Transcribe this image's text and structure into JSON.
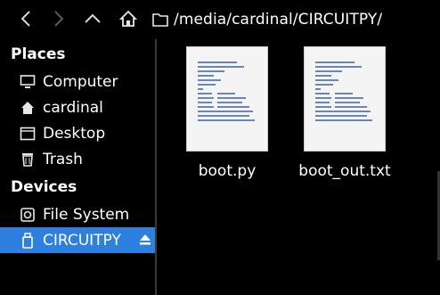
{
  "toolbar": {
    "path": "/media/cardinal/CIRCUITPY/"
  },
  "sidebar": {
    "places_header": "Places",
    "places": [
      {
        "label": "Computer",
        "icon": "monitor-icon"
      },
      {
        "label": "cardinal",
        "icon": "home-folder-icon"
      },
      {
        "label": "Desktop",
        "icon": "desktop-icon"
      },
      {
        "label": "Trash",
        "icon": "trash-icon"
      }
    ],
    "devices_header": "Devices",
    "devices": [
      {
        "label": "File System",
        "icon": "drive-icon"
      },
      {
        "label": "CIRCUITPY",
        "icon": "usb-drive-icon",
        "selected": true
      }
    ]
  },
  "files": [
    {
      "name": "boot.py",
      "icon": "text-file-icon"
    },
    {
      "name": "boot_out.txt",
      "icon": "text-file-icon"
    }
  ],
  "colors": {
    "background": "#000000",
    "selection": "#2d7fe0",
    "text": "#ffffff"
  }
}
